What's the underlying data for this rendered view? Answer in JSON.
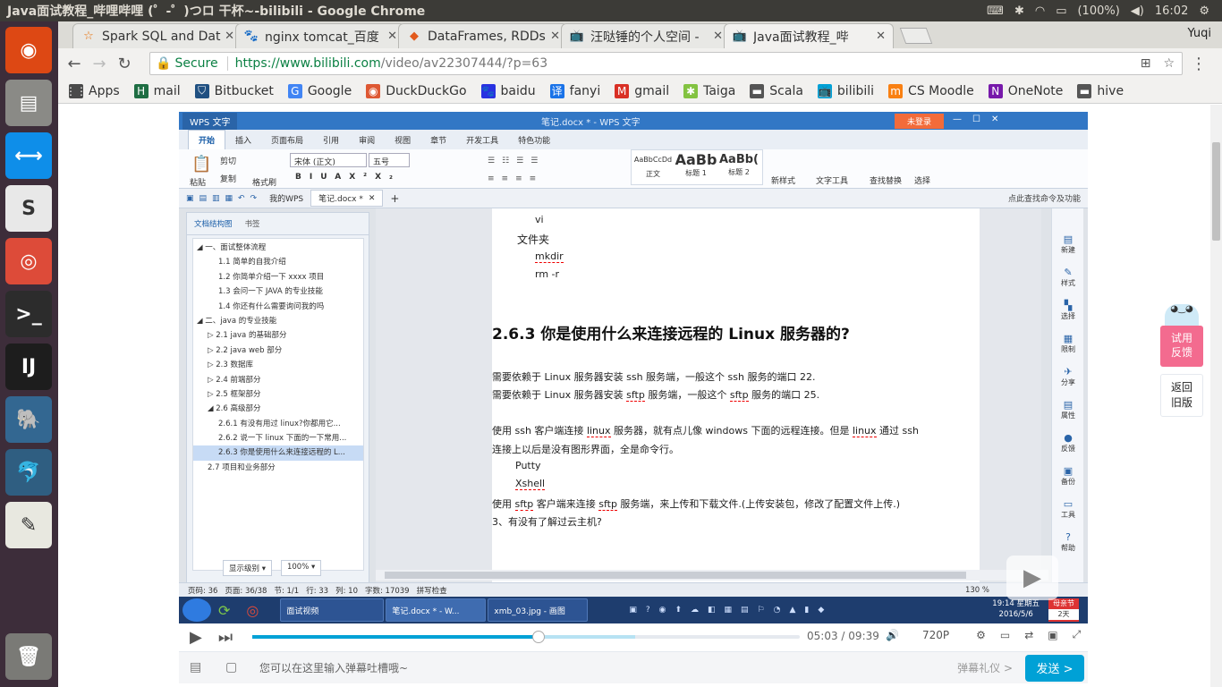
{
  "os": {
    "window_title": "Java面试教程_哔哩哔哩 (゜-゜)つロ 干杯~-bilibili - Google Chrome",
    "battery": "(100%)",
    "time": "16:02"
  },
  "launcher": [
    {
      "name": "ubuntu-icon",
      "glyph": "◉",
      "color": "#dd4814"
    },
    {
      "name": "files-icon",
      "glyph": "▤",
      "color": "#8a8a86"
    },
    {
      "name": "teamviewer-icon",
      "glyph": "⟷",
      "color": "#0e8ee9"
    },
    {
      "name": "slack-icon",
      "glyph": "S",
      "color": "#e8e8e8"
    },
    {
      "name": "chrome-icon",
      "glyph": "◎",
      "color": "#dd4b39"
    },
    {
      "name": "terminal-icon",
      "glyph": ">_",
      "color": "#2c2c2c"
    },
    {
      "name": "intellij-icon",
      "glyph": "IJ",
      "color": "#1d1d1d"
    },
    {
      "name": "postgres-icon",
      "glyph": "🐘",
      "color": "#336791"
    },
    {
      "name": "mysql-workbench-icon",
      "glyph": "🐬",
      "color": "#2f5e81"
    },
    {
      "name": "text-editor-icon",
      "glyph": "✎",
      "color": "#e8e8e0"
    },
    {
      "name": "trash-icon",
      "glyph": "🗑",
      "color": "#7a7a76"
    }
  ],
  "tabs": [
    {
      "label": "Spark SQL and Data",
      "icon": "☆",
      "icon_color": "#e8710a"
    },
    {
      "label": "nginx tomcat_百度",
      "icon": "🐾",
      "icon_color": "#2932e1"
    },
    {
      "label": "DataFrames, RDDs,",
      "icon": "◆",
      "icon_color": "#e25a1c"
    },
    {
      "label": "汪哒锤的个人空间 -",
      "icon": "📺",
      "icon_color": "#00a1d6"
    },
    {
      "label": "Java面试教程_哔",
      "icon": "📺",
      "icon_color": "#00a1d6"
    }
  ],
  "profile": "Yuqi",
  "omnibox": {
    "secure": "Secure",
    "url_host": "https://www.bilibili.com",
    "url_path": "/video/av22307444/?p=63"
  },
  "bookmarks": [
    {
      "label": "Apps",
      "icon": "⋮⋮",
      "color": "#4a4a4a"
    },
    {
      "label": "mail",
      "icon": "H",
      "color": "#1f6e43"
    },
    {
      "label": "Bitbucket",
      "icon": "⛉",
      "color": "#205081"
    },
    {
      "label": "Google",
      "icon": "G",
      "color": "#4285f4"
    },
    {
      "label": "DuckDuckGo",
      "icon": "◉",
      "color": "#de5833"
    },
    {
      "label": "baidu",
      "icon": "🐾",
      "color": "#2932e1"
    },
    {
      "label": "fanyi",
      "icon": "译",
      "color": "#1a73e8"
    },
    {
      "label": "gmail",
      "icon": "M",
      "color": "#d93025"
    },
    {
      "label": "Taiga",
      "icon": "✱",
      "color": "#83c341"
    },
    {
      "label": "Scala",
      "icon": "▬",
      "color": "#555555"
    },
    {
      "label": "bilibili",
      "icon": "📺",
      "color": "#00a1d6"
    },
    {
      "label": "CS Moodle",
      "icon": "m",
      "color": "#f98012"
    },
    {
      "label": "OneNote",
      "icon": "N",
      "color": "#7719aa"
    },
    {
      "label": "hive",
      "icon": "▬",
      "color": "#555555"
    }
  ],
  "wps": {
    "app_name": "WPS 文字",
    "doc_title": "笔记.docx * - WPS 文字",
    "login": "未登录",
    "ribbon_tabs": [
      "开始",
      "插入",
      "页面布局",
      "引用",
      "审阅",
      "视图",
      "章节",
      "开发工具",
      "特色功能"
    ],
    "ribbon_groups": [
      "粘贴",
      "剪切",
      "复制",
      "格式刷",
      "宋体 (正文)",
      "五号",
      "正文",
      "标题 1",
      "标题 2",
      "新样式",
      "文字工具",
      "查找替换",
      "选择"
    ],
    "style_samples": [
      "AaBbCcDd",
      "AaBb",
      "AaBb("
    ],
    "doc_tabs": [
      "我的WPS",
      "笔记.docx *"
    ],
    "help_search": "点此查找命令及功能",
    "nav_tabs": [
      "文档结构图",
      "书签"
    ],
    "nav_items": [
      {
        "text": "◢ 一、面试整体流程",
        "indent": 0,
        "sel": false
      },
      {
        "text": "1.1 简单的自我介绍",
        "indent": 2,
        "sel": false
      },
      {
        "text": "1.2 你简单介绍一下 xxxx 项目",
        "indent": 2,
        "sel": false
      },
      {
        "text": "1.3 会问一下 JAVA 的专业技能",
        "indent": 2,
        "sel": false
      },
      {
        "text": "1.4 你还有什么需要询问我的吗",
        "indent": 2,
        "sel": false
      },
      {
        "text": "◢ 二、java 的专业技能",
        "indent": 0,
        "sel": false
      },
      {
        "text": "▷ 2.1 java 的基础部分",
        "indent": 1,
        "sel": false
      },
      {
        "text": "▷ 2.2 java web 部分",
        "indent": 1,
        "sel": false
      },
      {
        "text": "▷ 2.3 数据库",
        "indent": 1,
        "sel": false
      },
      {
        "text": "▷ 2.4 前端部分",
        "indent": 1,
        "sel": false
      },
      {
        "text": "▷ 2.5 框架部分",
        "indent": 1,
        "sel": false
      },
      {
        "text": "◢ 2.6 高级部分",
        "indent": 1,
        "sel": false
      },
      {
        "text": "2.6.1 有没有用过 linux?你都用它...",
        "indent": 2,
        "sel": false
      },
      {
        "text": "2.6.2 说一下 linux 下面的一下常用...",
        "indent": 2,
        "sel": false
      },
      {
        "text": "2.6.3 你是使用什么来连接远程的 L...",
        "indent": 2,
        "sel": true
      },
      {
        "text": "2.7 项目和业务部分",
        "indent": 1,
        "sel": false
      }
    ],
    "nav_footer": [
      "显示级别 ▾",
      "100% ▾"
    ],
    "doc_lines": {
      "l1": "vi",
      "l2": "文件夹",
      "l3": "mkdir",
      "l4": "rm -r",
      "heading": "2.6.3  你是使用什么来连接远程的 Linux 服务器的?",
      "p1": "需要依赖于 Linux 服务器安装 ssh 服务端，一般这个 ssh 服务的端口 22.",
      "p2a": "需要依赖于 Linux 服务器安装 ",
      "p2b": "sftp",
      "p2c": " 服务端，一般这个 ",
      "p2d": "sftp",
      "p2e": " 服务的端口 25.",
      "p3a": "使用 ssh 客户端连接 ",
      "p3b": "linux",
      "p3c": " 服务器，就有点儿像 windows 下面的远程连接。但是 ",
      "p3d": "linux",
      "p3e": " 通过 ssh",
      "p4": "连接上以后是没有图形界面，全是命令行。",
      "p5": "Putty",
      "p6": "Xshell",
      "p7a": "使用 ",
      "p7b": "sftp",
      "p7c": " 客户端来连接 ",
      "p7d": "sftp",
      "p7e": " 服务端，来上传和下载文件.(上传安装包，修改了配置文件上传.)",
      "p8": "3、有没有了解过云主机?"
    },
    "right_panel": [
      "新建",
      "样式",
      "选择",
      "限制",
      "分享",
      "属性",
      "反馈",
      "备份",
      "工具",
      "帮助"
    ],
    "status": [
      "页码: 36",
      "页面: 36/38",
      "节: 1/1",
      "行: 33",
      "列: 10",
      "字数: 17039",
      "拼写检查"
    ],
    "zoom": "130 %",
    "taskbar": [
      "面试视频",
      "笔记.docx * - W...",
      "xmb_03.jpg - 画图"
    ],
    "clock_time": "19:14 星期五",
    "clock_date": "2016/5/6",
    "holiday": "母亲节",
    "holiday_sub": "2天"
  },
  "player": {
    "current": "05:03",
    "separator": "/",
    "duration": "09:39",
    "quality": "720P",
    "progress_played": 0.523,
    "progress_buffered": 0.7
  },
  "danmaku": {
    "placeholder": "您可以在这里输入弹幕吐槽哦~",
    "etiquette": "弹幕礼仪 >",
    "send": "发送 >"
  },
  "side_buttons": {
    "feedback": "试用反馈",
    "back_old": "返回旧版"
  }
}
